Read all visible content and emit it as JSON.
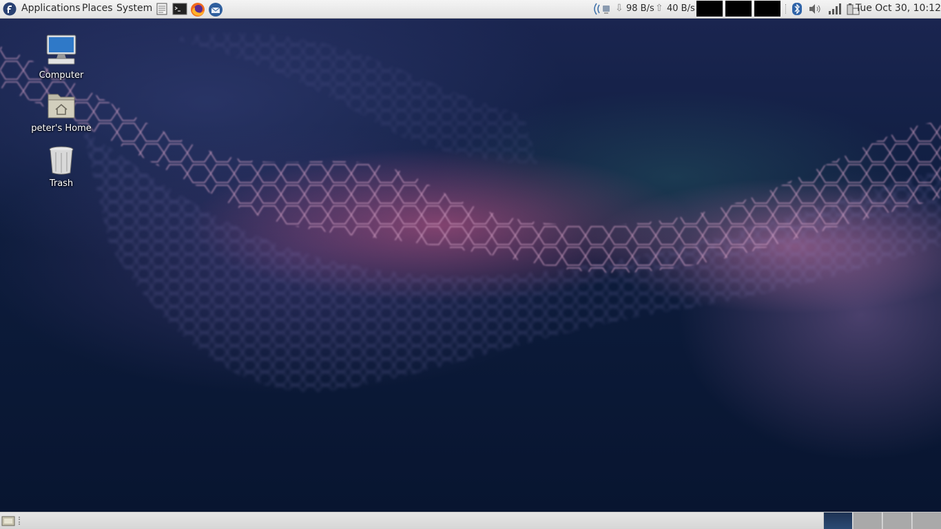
{
  "top_panel": {
    "menus": {
      "applications": "Applications",
      "places": "Places",
      "system": "System"
    },
    "launchers": [
      "text-editor-icon",
      "terminal-icon",
      "firefox-icon",
      "thunderbird-icon"
    ],
    "network": {
      "download_rate": "98 B/s",
      "upload_rate": "40 B/s"
    },
    "clock": "Tue Oct 30, 10:12"
  },
  "desktop": {
    "icons": [
      {
        "label": "Computer",
        "icon": "computer-icon"
      },
      {
        "label": "peter's Home",
        "icon": "home-folder-icon"
      },
      {
        "label": "Trash",
        "icon": "trash-icon"
      }
    ]
  },
  "bottom_panel": {
    "workspaces": 4,
    "active_workspace": 1
  },
  "colors": {
    "panel": "#e6e6e6",
    "active_workspace": "#243d62",
    "fedora_blue": "#294172"
  }
}
